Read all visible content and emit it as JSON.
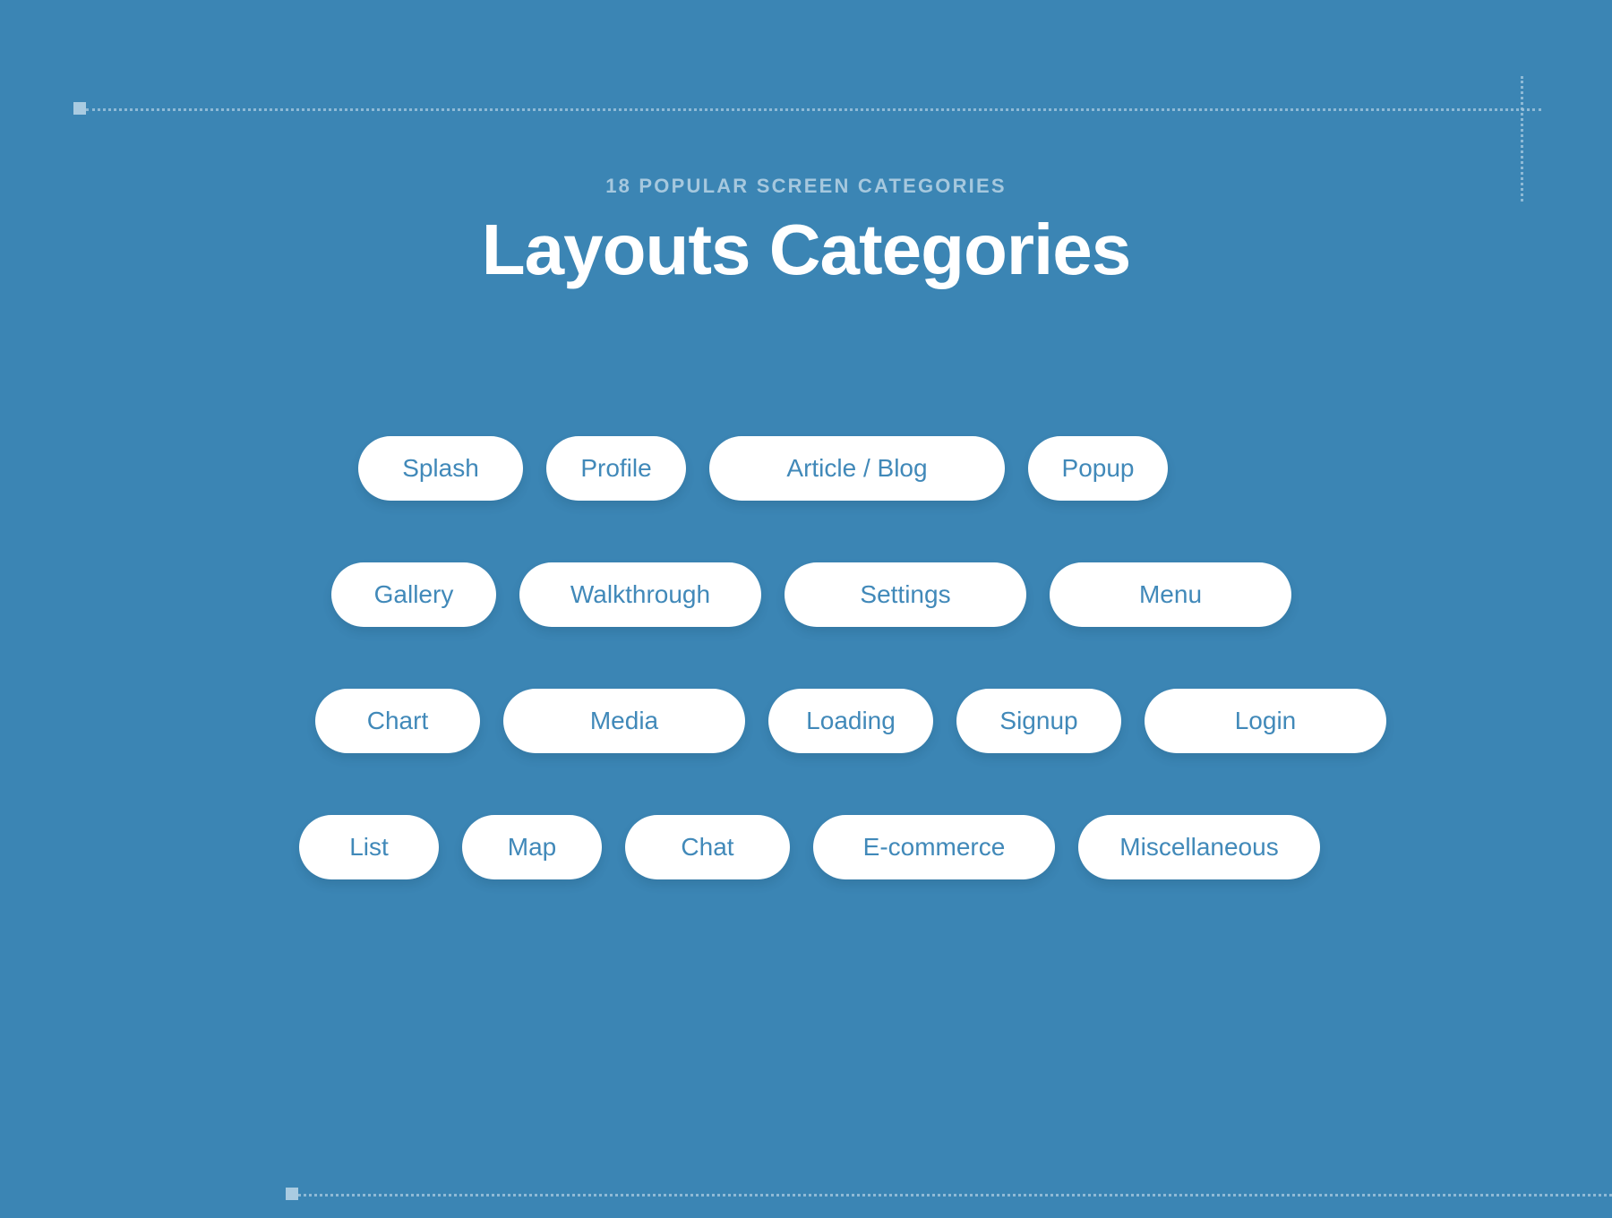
{
  "background_color": "#3b85b4",
  "header": {
    "eyebrow": "18 POPULAR SCREEN CATEGORIES",
    "title": "Layouts Categories",
    "eyebrow_color": "#a6c8de",
    "title_color": "#ffffff"
  },
  "pills": {
    "text_color": "#4189b9",
    "background_color": "#ffffff",
    "rows": [
      {
        "items": [
          {
            "label": "Splash",
            "size": "w-md"
          },
          {
            "label": "Profile",
            "size": "w-sm"
          },
          {
            "label": "Article / Blog",
            "size": "w-xxl"
          },
          {
            "label": "Popup",
            "size": "w-sm"
          }
        ]
      },
      {
        "items": [
          {
            "label": "Gallery",
            "size": "w-md"
          },
          {
            "label": "Walkthrough",
            "size": "w-xl"
          },
          {
            "label": "Settings",
            "size": "w-xl"
          },
          {
            "label": "Menu",
            "size": "w-xl"
          }
        ]
      },
      {
        "items": [
          {
            "label": "Chart",
            "size": "w-md"
          },
          {
            "label": "Media",
            "size": "w-xl"
          },
          {
            "label": "Loading",
            "size": "w-md"
          },
          {
            "label": "Signup",
            "size": "w-md"
          },
          {
            "label": "Login",
            "size": "w-xl"
          }
        ]
      },
      {
        "items": [
          {
            "label": "List",
            "size": "w-sm"
          },
          {
            "label": "Map",
            "size": "w-sm"
          },
          {
            "label": "Chat",
            "size": "w-md"
          },
          {
            "label": "E-commerce",
            "size": "w-xl"
          },
          {
            "label": "Miscellaneous",
            "size": "w-xl"
          }
        ]
      }
    ]
  },
  "guides": {
    "color": "#9ec4dd",
    "handle_color": "#a9cbe1"
  }
}
